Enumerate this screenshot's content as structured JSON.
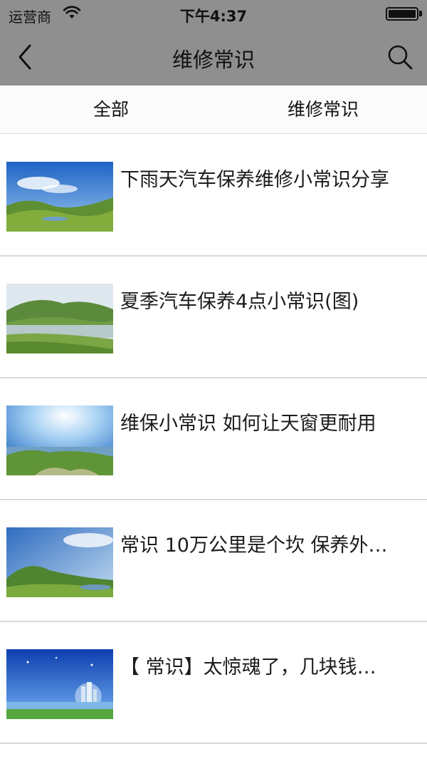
{
  "status_bar": {
    "carrier": "运营商",
    "time": "下午4:37",
    "wifi_icon": "wifi-icon",
    "battery_icon": "battery-icon"
  },
  "nav": {
    "title": "维修常识",
    "back_icon": "back-chevron-icon",
    "search_icon": "search-icon"
  },
  "tabs": [
    {
      "label": "全部"
    },
    {
      "label": "维修常识"
    }
  ],
  "articles": [
    {
      "title": "下雨天汽车保养维修小常识分享",
      "thumbnail": "mountain-lake-landscape"
    },
    {
      "title": "夏季汽车保养4点小常识(图)",
      "thumbnail": "green-hills-lake-landscape"
    },
    {
      "title": "维保小常识 如何让天窗更耐用",
      "thumbnail": "coastal-hills-landscape"
    },
    {
      "title": "常识 10万公里是个坎 保养外…",
      "thumbnail": "hills-sky-landscape"
    },
    {
      "title": "【 常识】太惊魂了，几块钱…",
      "thumbnail": "city-bubble-illustration"
    }
  ],
  "colors": {
    "nav_background": "#8f8f8f",
    "divider": "#d9d9d9"
  }
}
